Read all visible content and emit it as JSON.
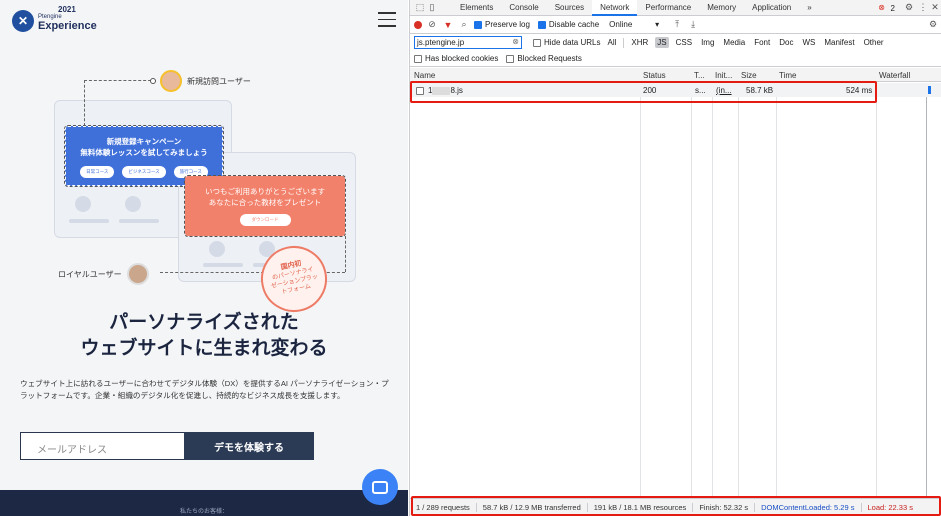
{
  "site": {
    "logo": {
      "year": "2021",
      "small": "Ptengine",
      "big": "Experience"
    },
    "personas": {
      "new_user": "新規訪問ユーザー",
      "loyal_user": "ロイヤルユーザー"
    },
    "blue_card": {
      "line1": "新規登録キャンペーン",
      "line2": "無料体験レッスンを試してみましょう",
      "pills": [
        "日常コース",
        "ビジネスコース",
        "旅行コース"
      ]
    },
    "salmon_card": {
      "line1": "いつもご利用ありがとうございます",
      "line2": "あなたに合った教材をプレゼント",
      "button": "ダウンロード"
    },
    "stamp": {
      "big": "国内初",
      "lines": [
        "のパーソナライ",
        "ゼーションプラッ",
        "トフォーム"
      ]
    },
    "headline": {
      "line1": "パーソナライズされた",
      "line2": "ウェブサイトに生まれ変わる"
    },
    "description": "ウェブサイト上に訪れるユーザーに合わせてデジタル体験（DX）を提供するAI パーソナライゼーション・プラットフォームです。企業・組織のデジタル化を促進し、持続的なビジネス成長を支援します。",
    "email_placeholder": "メールアドレス",
    "demo_button": "デモを体験する",
    "footer_text": "私たちのお客様："
  },
  "devtools": {
    "tabs": [
      "Elements",
      "Console",
      "Sources",
      "Network",
      "Performance",
      "Memory",
      "Application",
      "»"
    ],
    "active_tab": "Network",
    "error_count": "2",
    "toolbar": {
      "preserve_log": "Preserve log",
      "disable_cache": "Disable cache",
      "throttle": "Online"
    },
    "filter": {
      "value": "js.ptengine.jp",
      "hide_data_urls": "Hide data URLs",
      "types": [
        "All",
        "XHR",
        "JS",
        "CSS",
        "Img",
        "Media",
        "Font",
        "Doc",
        "WS",
        "Manifest",
        "Other"
      ],
      "active_type": "JS",
      "blocked_cookies": "Has blocked cookies",
      "blocked_requests": "Blocked Requests"
    },
    "columns": [
      "Name",
      "Status",
      "T...",
      "Init...",
      "Size",
      "Time",
      "Waterfall"
    ],
    "row": {
      "name_a": "1",
      "name_b": "8.js",
      "status": "200",
      "type": "s...",
      "initiator": "(in...",
      "size": "58.7 kB",
      "time": "524 ms"
    },
    "statusbar": {
      "requests": "1 / 289 requests",
      "transferred": "58.7 kB / 12.9 MB transferred",
      "resources": "191 kB / 18.1 MB resources",
      "finish": "Finish: 52.32 s",
      "dcl": "DOMContentLoaded: 5.29 s",
      "load": "Load: 22.33 s"
    },
    "colors": {
      "highlight": "#e51b12",
      "accent": "#1a73e8"
    }
  }
}
